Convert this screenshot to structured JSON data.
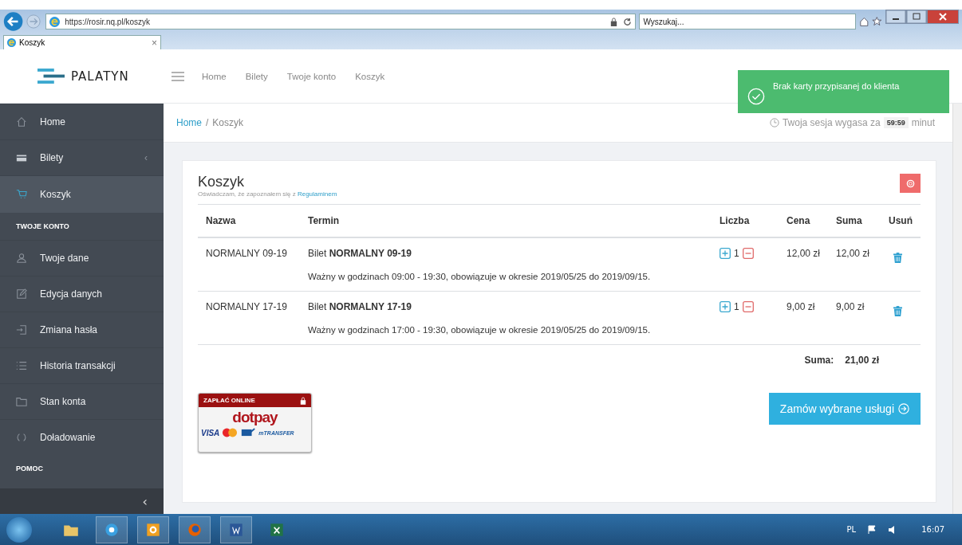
{
  "browser": {
    "address": "https://rosir.nq.pl/koszyk",
    "search_placeholder": "Wyszukaj...",
    "tab": {
      "title": "Koszyk",
      "close": "×"
    }
  },
  "header": {
    "logo": "PALATYN",
    "nav": [
      {
        "label": "Home"
      },
      {
        "label": "Bilety"
      },
      {
        "label": "Twoje konto"
      },
      {
        "label": "Koszyk"
      }
    ]
  },
  "toast": {
    "message": "Brak karty przypisanej do klienta"
  },
  "sidebar": {
    "items": [
      {
        "kind": "item",
        "label": "Home",
        "selected": false
      },
      {
        "kind": "item",
        "label": "Bilety",
        "selected": false,
        "chevron": "‹"
      },
      {
        "kind": "item",
        "label": "Koszyk",
        "selected": true
      },
      {
        "kind": "section",
        "label": "TWOJE KONTO"
      },
      {
        "kind": "item",
        "label": "Twoje dane",
        "selected": false
      },
      {
        "kind": "item",
        "label": "Edycja danych",
        "selected": false
      },
      {
        "kind": "item",
        "label": "Zmiana hasła",
        "selected": false
      },
      {
        "kind": "item",
        "label": "Historia transakcji",
        "selected": false
      },
      {
        "kind": "item",
        "label": "Stan konta",
        "selected": false
      },
      {
        "kind": "item",
        "label": "Doładowanie",
        "selected": false
      },
      {
        "kind": "section",
        "label": "POMOC"
      }
    ],
    "collapse": "‹"
  },
  "breadcrumb": {
    "separator": "/",
    "items": [
      {
        "label": "Home"
      },
      {
        "label": "Koszyk"
      }
    ]
  },
  "session": {
    "prefix": "Twoja sesja wygasa za",
    "time": "59:59",
    "suffix": "minut"
  },
  "cart": {
    "title": "Koszyk",
    "notice": "Oświadczam, że zapoznałem się z",
    "notice_link": "Regulaminem",
    "columns": [
      "Nazwa",
      "Termin",
      "Liczba",
      "Cena",
      "Suma",
      "Usuń"
    ],
    "rows": [
      {
        "name": "NORMALNY 09-19",
        "title": "Bilet **NORMALNY 09-19**",
        "description": "Ważny w godzinach 09:00 - 19:30, obowiązuje w okresie 2019/05/25 do 2019/09/15.",
        "quantity": "1",
        "price": "12,00 zł",
        "sum": "12,00 zł"
      },
      {
        "name": "NORMALNY 17-19",
        "title": "Bilet **NORMALNY 17-19**",
        "description": "Ważny w godzinach 17:00 - 19:30, obowiązuje w okresie 2019/05/25 do 2019/09/15.",
        "quantity": "1",
        "price": "9,00 zł",
        "sum": "9,00 zł"
      }
    ],
    "total_label": "Suma:",
    "total": "21,00 zł",
    "payment": {
      "header": "ZAPŁAĆ ONLINE",
      "brand": "dotpay",
      "cards": [
        "VISA",
        "mTRANSFER"
      ]
    },
    "order_button": "Zamów wybrane usługi"
  },
  "taskbar": {
    "language": "PL",
    "clock": "16:07"
  }
}
